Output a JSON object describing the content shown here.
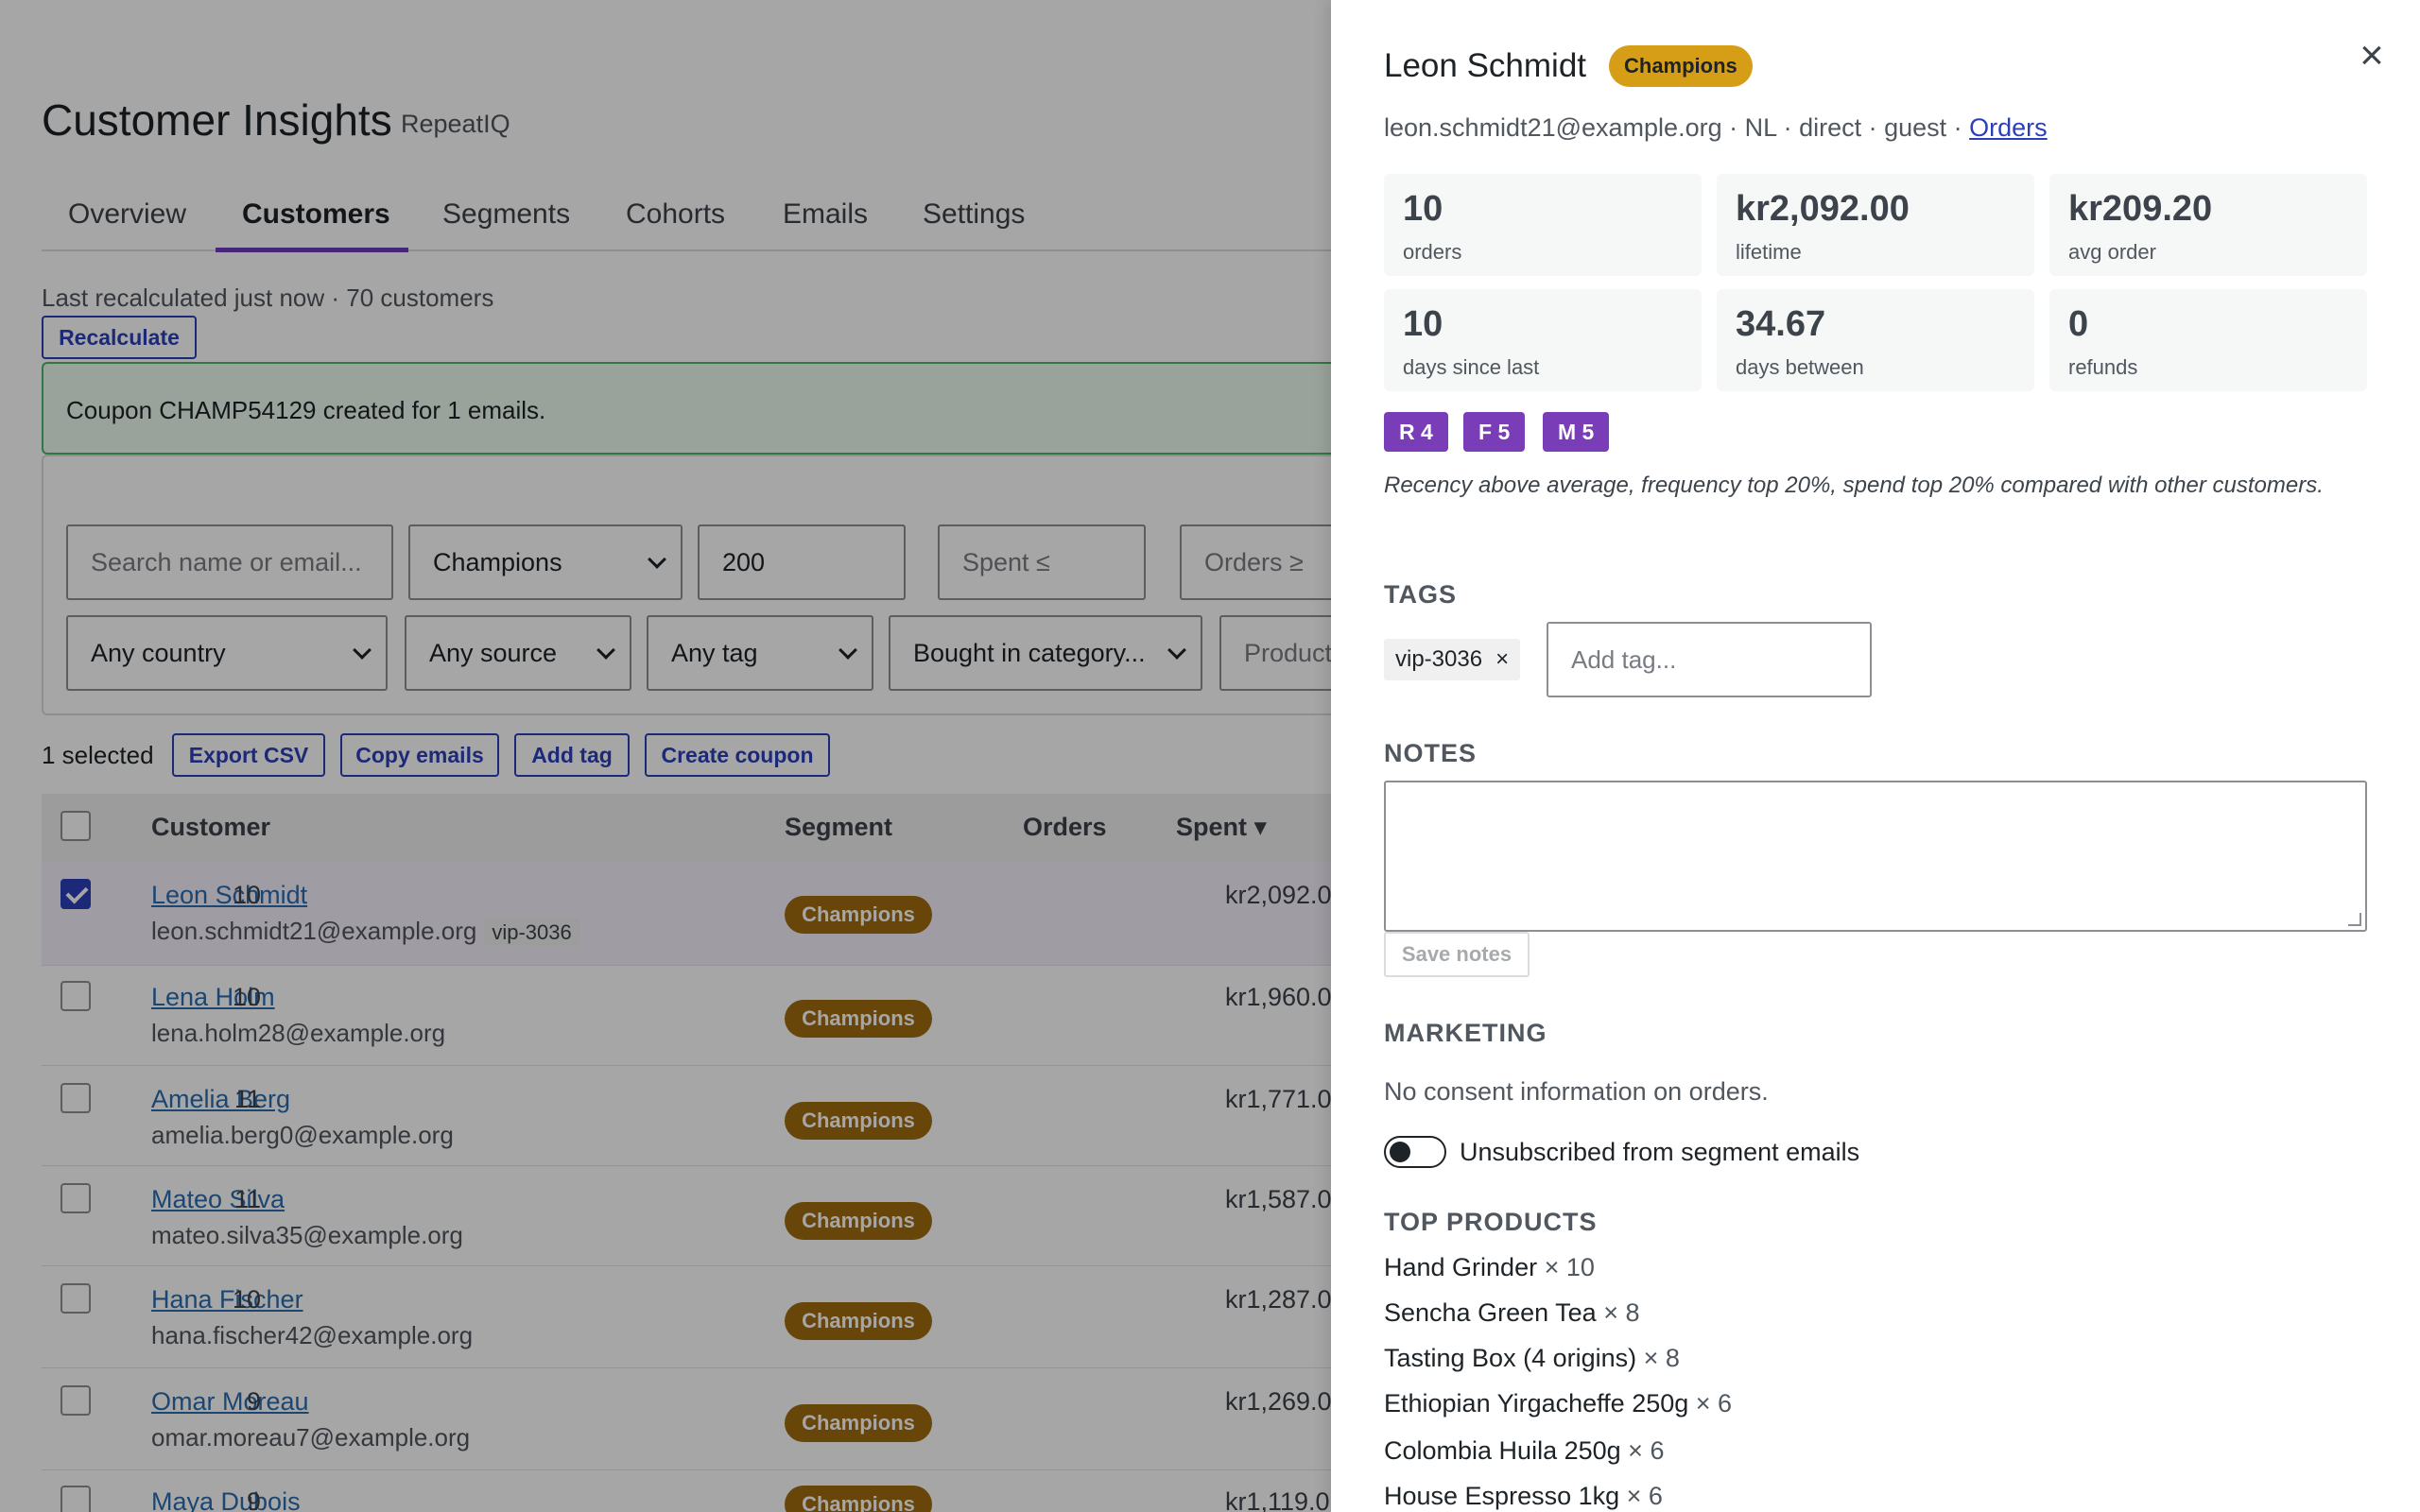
{
  "app": {
    "title": "Customer Insights",
    "subtitle": "RepeatIQ"
  },
  "tabs": [
    {
      "label": "Overview"
    },
    {
      "label": "Customers",
      "active": true
    },
    {
      "label": "Segments"
    },
    {
      "label": "Cohorts"
    },
    {
      "label": "Emails"
    },
    {
      "label": "Settings"
    }
  ],
  "status": {
    "text": "Last recalculated just now · 70 customers",
    "recalculate_label": "Recalculate"
  },
  "notice": {
    "text": "Coupon CHAMP54129 created for 1 emails."
  },
  "filters": {
    "search_placeholder": "Search name or email...",
    "segment_value": "Champions",
    "spent_min_value": "200",
    "spent_max_placeholder": "Spent ≤",
    "orders_min_placeholder": "Orders ≥",
    "country_value": "Any country",
    "source_value": "Any source",
    "tag_value": "Any tag",
    "category_value": "Bought in category...",
    "product_placeholder": "Product"
  },
  "bulk": {
    "selected_text": "1 selected",
    "export_label": "Export CSV",
    "copy_label": "Copy emails",
    "add_tag_label": "Add tag",
    "coupon_label": "Create coupon"
  },
  "table": {
    "headers": {
      "customer": "Customer",
      "segment": "Segment",
      "orders": "Orders",
      "spent": "Spent ▾"
    },
    "rows": [
      {
        "name": "Leon Schmidt",
        "email": "leon.schmidt21@example.org",
        "tag": "vip-3036",
        "segment": "Champions",
        "orders": "10",
        "spent": "kr2,092.0",
        "checked": true
      },
      {
        "name": "Lena Holm",
        "email": "lena.holm28@example.org",
        "tag": "",
        "segment": "Champions",
        "orders": "10",
        "spent": "kr1,960.0",
        "checked": false
      },
      {
        "name": "Amelia Berg",
        "email": "amelia.berg0@example.org",
        "tag": "",
        "segment": "Champions",
        "orders": "11",
        "spent": "kr1,771.0",
        "checked": false
      },
      {
        "name": "Mateo Silva",
        "email": "mateo.silva35@example.org",
        "tag": "",
        "segment": "Champions",
        "orders": "11",
        "spent": "kr1,587.0",
        "checked": false
      },
      {
        "name": "Hana Fischer",
        "email": "hana.fischer42@example.org",
        "tag": "",
        "segment": "Champions",
        "orders": "10",
        "spent": "kr1,287.0",
        "checked": false
      },
      {
        "name": "Omar Moreau",
        "email": "omar.moreau7@example.org",
        "tag": "",
        "segment": "Champions",
        "orders": "9",
        "spent": "kr1,269.0",
        "checked": false
      },
      {
        "name": "Maya Dubois",
        "email": "",
        "tag": "",
        "segment": "Champions",
        "orders": "9",
        "spent": "kr1,119.0",
        "checked": false
      }
    ]
  },
  "drawer": {
    "name": "Leon Schmidt",
    "segment_badge": "Champions",
    "close_glyph": "×",
    "meta_text": "leon.schmidt21@example.org · NL · direct · guest · ",
    "orders_link": "Orders",
    "stats": [
      {
        "value": "10",
        "label": "orders"
      },
      {
        "value": "kr2,092.00",
        "label": "lifetime"
      },
      {
        "value": "kr209.20",
        "label": "avg order"
      },
      {
        "value": "10",
        "label": "days since last"
      },
      {
        "value": "34.67",
        "label": "days between"
      },
      {
        "value": "0",
        "label": "refunds"
      }
    ],
    "rfm": {
      "r": "R 4",
      "f": "F 5",
      "m": "M 5"
    },
    "rfm_description": "Recency above average, frequency top 20%, spend top 20% compared with other customers.",
    "tags_heading": "TAGS",
    "tag": "vip-3036",
    "tag_remove": "×",
    "add_tag_placeholder": "Add tag...",
    "notes_heading": "NOTES",
    "notes_value": "",
    "save_notes_label": "Save notes",
    "marketing_heading": "MARKETING",
    "marketing_text": "No consent information on orders.",
    "unsubscribe_label": "Unsubscribed from segment emails",
    "unsubscribed": false,
    "top_products_heading": "TOP PRODUCTS",
    "top_products": [
      {
        "name": "Hand Grinder",
        "qty": "× 10"
      },
      {
        "name": "Sencha Green Tea",
        "qty": "× 8"
      },
      {
        "name": "Tasting Box (4 origins)",
        "qty": "× 8"
      },
      {
        "name": "Ethiopian Yirgacheffe 250g",
        "qty": "× 6"
      },
      {
        "name": "Colombia Huila 250g",
        "qty": "× 6"
      },
      {
        "name": "House Espresso 1kg",
        "qty": "× 6"
      }
    ]
  },
  "colors": {
    "accent_blue": "#2c3fb8",
    "champions_badge": "#a06a0d",
    "drawer_badge": "#d69e16",
    "rfm_badge": "#7a3db8",
    "notice_border": "#4ab866"
  }
}
